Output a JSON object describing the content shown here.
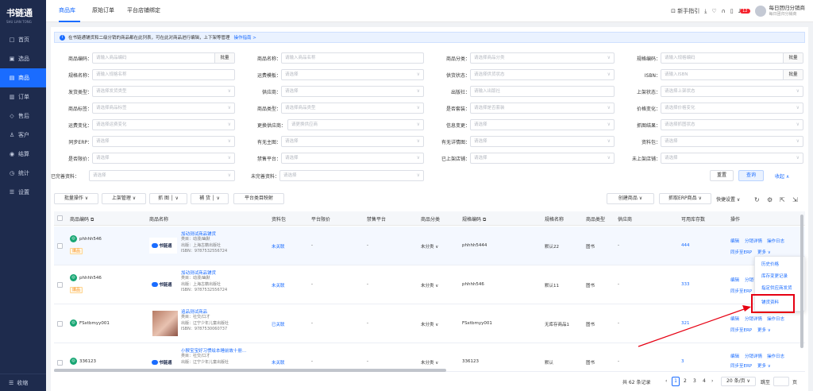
{
  "app": {
    "logo": "书链通",
    "logo_sub": "SHU LIAN TONG"
  },
  "nav": [
    {
      "icon": "□",
      "label": "首页"
    },
    {
      "icon": "▣",
      "label": "选品"
    },
    {
      "icon": "▤",
      "label": "商品"
    },
    {
      "icon": "▥",
      "label": "订单"
    },
    {
      "icon": "◇",
      "label": "售后"
    },
    {
      "icon": "♙",
      "label": "客户"
    },
    {
      "icon": "◉",
      "label": "结算"
    },
    {
      "icon": "◷",
      "label": "统计"
    },
    {
      "icon": "☰",
      "label": "设置"
    }
  ],
  "nav_active_index": 2,
  "nav_bottom": "收缩",
  "tabs": [
    "商品库",
    "原始订单",
    "平台店铺绑定"
  ],
  "topbar": {
    "guide": "新手指引",
    "badge": "12",
    "user_name": "每日团归分销商",
    "user_sub": "每日团归分销商"
  },
  "info": {
    "text": "在书链通铺货和二级分销的商品都在此列表，可在此对商品进行编辑，上下架等管理",
    "link": "操作指南 >"
  },
  "filters": {
    "r1": {
      "l1": "商品编码：",
      "p1": "请输入商品编码",
      "b1": "批量",
      "l2": "商品名称：",
      "p2": "请输入商品名称",
      "l3": "商品分类：",
      "p3": "请选择商品分类",
      "l4": "规格编码：",
      "p4": "请输入规格编码",
      "b4": "批量"
    },
    "r2": {
      "l1": "规格名称：",
      "p1": "请输入规格名称",
      "l2": "运费模板：",
      "p2": "请选择",
      "l3": "供货状态：",
      "p3": "请选择供货状态",
      "l4": "ISBN：",
      "p4": "请输入ISBN",
      "b4": "批量"
    },
    "r3": {
      "l1": "发货类型：",
      "p1": "请选择发货类型",
      "l2": "供应商：",
      "p2": "请选择",
      "l3": "出版社：",
      "p3": "请输入出版社",
      "l4": "上架状态：",
      "p4": "请选择上架状态"
    },
    "r4": {
      "l1": "商品标签：",
      "p1": "请选择商品标签",
      "l2": "商品类型：",
      "p2": "请选择商品类型",
      "l3": "是否套装：",
      "p3": "请选择是否套装",
      "l4": "价格变化：",
      "p4": "请选择价格变化"
    },
    "r5": {
      "l1": "运费变化：",
      "p1": "请选择运费变化",
      "l2": "更换供应商：",
      "p2": "请更换供应商",
      "l3": "信息变更：",
      "p3": "请选择",
      "l4": "抓图结果：",
      "p4": "请选择抓图状态"
    },
    "r6": {
      "l1": "同步ERP：",
      "p1": "请选择",
      "l2": "有无主图：",
      "p2": "请选择",
      "l3": "有无详情图：",
      "p3": "请选择",
      "l4": "资料包：",
      "p4": "请选择"
    },
    "r7": {
      "l1": "是否限价：",
      "p1": "请选择",
      "l2": "禁售平台：",
      "p2": "请选择",
      "l3": "已上架店铺：",
      "p3": "请选择",
      "l4": "未上架店铺：",
      "p4": "请选择"
    },
    "r8": {
      "l1": "已完善资料：",
      "p1": "请选择",
      "l2": "未完善资料：",
      "p2": "请选择"
    },
    "reset": "重置",
    "query": "查询",
    "collapse": "收起 ∧"
  },
  "toolbar": {
    "batch": "批量操作",
    "listing": "上架管理",
    "grab": "抓 图",
    "supplement": "補 货",
    "mapping": "平台类目映射",
    "create": "创建商品",
    "erp": "抓取ERP商品",
    "quick": "快捷设置"
  },
  "table": {
    "headers": [
      "商品编码",
      "商品名称",
      "资料包",
      "平台限价",
      "禁售平台",
      "商品分类",
      "规格编码",
      "规格名称",
      "商品类型",
      "供应商",
      "可用库存数",
      "操作"
    ],
    "rows": [
      {
        "code": "phhhh546",
        "tag": "爆品",
        "brand": "书链通",
        "name": "加动测试商品铺货",
        "m1": "类目：动漫/幽默",
        "m2": "出版：上海古籍出版社",
        "m3": "ISBN：9787532556724",
        "pkg": "未关联",
        "limit": "-",
        "ban": "-",
        "cat": "未分类",
        "spec": "phhhh5444",
        "sname": "默认22",
        "type": "图书",
        "supplier": "-",
        "stock": "444"
      },
      {
        "code": "phhhh546",
        "tag": "爆品",
        "brand": "书链通",
        "name": "加动测试商品铺货",
        "m1": "类目：动漫/幽默",
        "m2": "出版：上海古籍出版社",
        "m3": "ISBN：9787532556724",
        "pkg": "未关联",
        "limit": "-",
        "ban": "-",
        "cat": "未分类",
        "spec": "phhhh546",
        "sname": "默认11",
        "type": "图书",
        "supplier": "-",
        "stock": "333"
      },
      {
        "code": "FSxtbmyy001",
        "tag": "",
        "brand": "",
        "name": "追品测试商品",
        "m1": "类目：社交/口才",
        "m2": "出版：辽宁少年儿童出版社",
        "m3": "ISBN：9787530060737",
        "pkg": "已关联",
        "limit": "-",
        "ban": "-",
        "cat": "未分类",
        "spec": "FSxtbmyy001",
        "sname": "无库存商品1",
        "type": "图书",
        "supplier": "-",
        "stock": "321"
      },
      {
        "code": "336123",
        "tag": "",
        "brand": "书链通",
        "name": "小猴宝宝好习惯绘本睡前故十册...",
        "m1": "类目：社交/口才",
        "m2": "出版：辽宁少年儿童出版社",
        "m3": "",
        "pkg": "未关联",
        "limit": "-",
        "ban": "-",
        "cat": "未分类",
        "spec": "336123",
        "sname": "默认",
        "type": "图书",
        "supplier": "-",
        "stock": "3"
      }
    ],
    "ops": {
      "edit": "编辑",
      "dist": "分销详情",
      "log": "操作日志",
      "sync": "同步至ERP",
      "more": "更多 ∨"
    }
  },
  "dropdown": [
    "历史价格",
    "库存变更记录",
    "指定供应商发货",
    "铺货资料"
  ],
  "pager": {
    "total": "共 62 条记录",
    "pages": [
      "1",
      "2",
      "3",
      "4"
    ],
    "size": "20 条/页",
    "jump": "跳至",
    "page_suffix": "页"
  },
  "colors": {
    "primary": "#1a6cff",
    "sidebar": "#1e2b4d",
    "highlight": "#e60012",
    "arrow": "#e60012"
  }
}
